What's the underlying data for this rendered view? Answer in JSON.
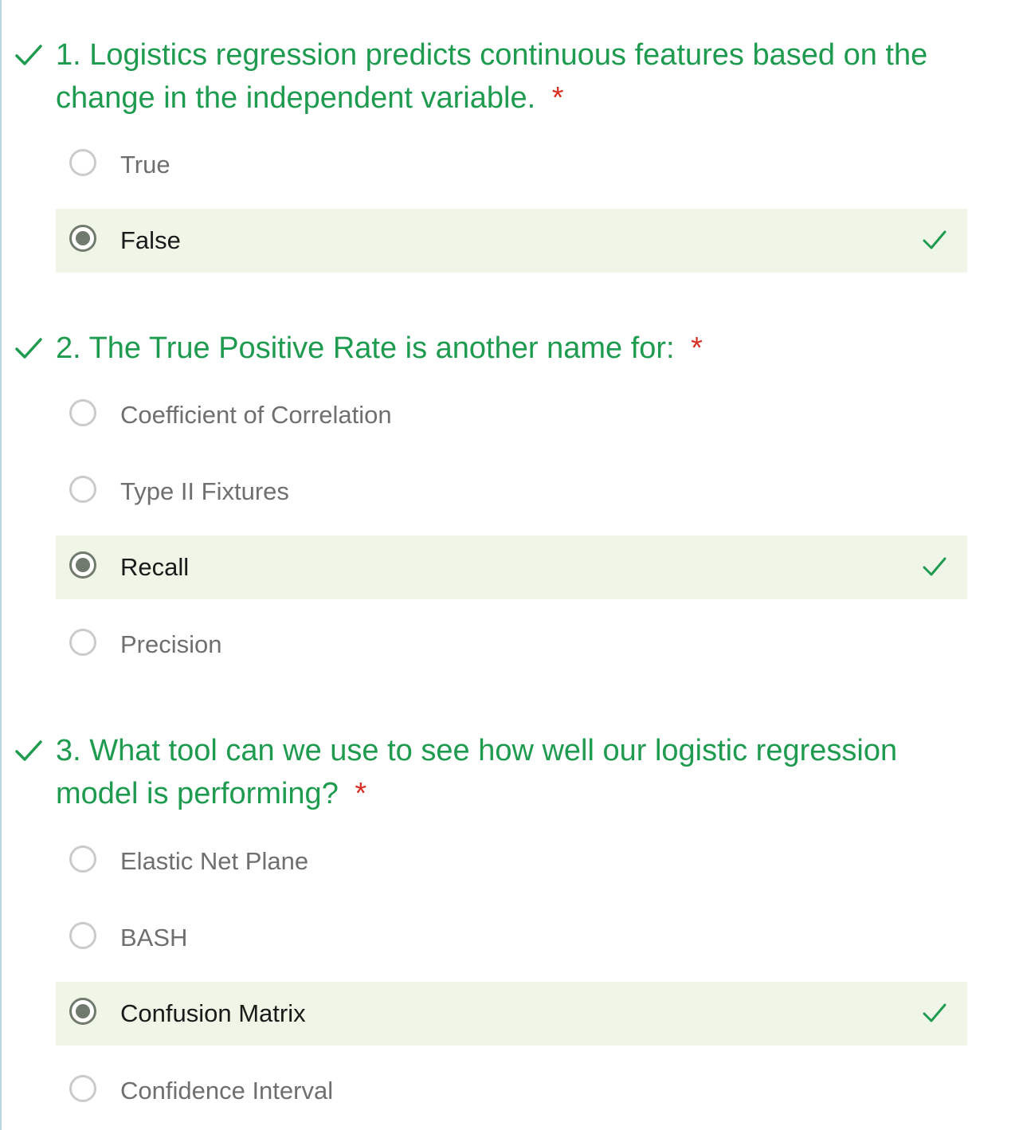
{
  "colors": {
    "accent_green": "#1e9b4f",
    "required_red": "#d93025",
    "correct_row_bg": "#eff6e8",
    "selected_radio": "#707a6d",
    "unselected_radio": "#cbcbcb"
  },
  "questions": [
    {
      "number": "1.",
      "text": "Logistics regression predicts continuous features based on the change in the independent variable.",
      "required_mark": "*",
      "status_icon": "check-icon",
      "options": [
        {
          "label": "True",
          "selected": false,
          "correct": false
        },
        {
          "label": "False",
          "selected": true,
          "correct": true
        }
      ]
    },
    {
      "number": "2.",
      "text": "The True Positive Rate is another name for:",
      "required_mark": "*",
      "status_icon": "check-icon",
      "options": [
        {
          "label": "Coefficient of Correlation",
          "selected": false,
          "correct": false
        },
        {
          "label": "Type II Fixtures",
          "selected": false,
          "correct": false
        },
        {
          "label": "Recall",
          "selected": true,
          "correct": true
        },
        {
          "label": "Precision",
          "selected": false,
          "correct": false
        }
      ]
    },
    {
      "number": "3.",
      "text": "What tool can we use to see how well our logistic regression model is performing?",
      "required_mark": "*",
      "status_icon": "check-icon",
      "options": [
        {
          "label": "Elastic Net Plane",
          "selected": false,
          "correct": false
        },
        {
          "label": "BASH",
          "selected": false,
          "correct": false
        },
        {
          "label": "Confusion Matrix",
          "selected": true,
          "correct": true
        },
        {
          "label": "Confidence Interval",
          "selected": false,
          "correct": false
        }
      ]
    }
  ]
}
